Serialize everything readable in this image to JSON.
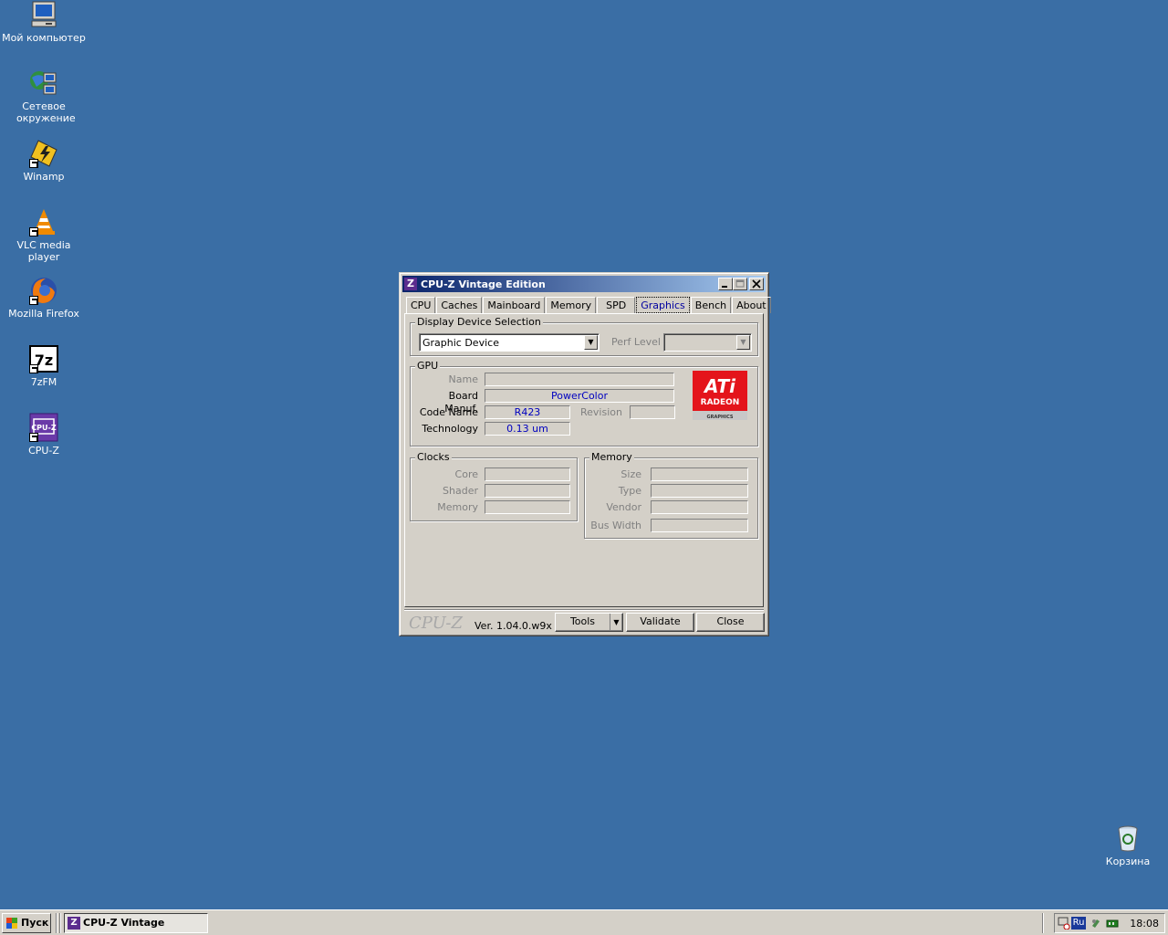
{
  "desktop": {
    "icons": [
      {
        "label": "Мой компьютер",
        "icon": "my-computer-icon"
      },
      {
        "label": "Сетевое окружение",
        "icon": "network-places-icon"
      },
      {
        "label": "Winamp",
        "icon": "winamp-icon"
      },
      {
        "label": "VLC media player",
        "icon": "vlc-icon"
      },
      {
        "label": "Mozilla Firefox",
        "icon": "firefox-icon"
      },
      {
        "label": "7zFM",
        "icon": "7zip-icon"
      },
      {
        "label": "CPU-Z",
        "icon": "cpuz-icon"
      },
      {
        "label": "Корзина",
        "icon": "recycle-bin-icon"
      }
    ]
  },
  "window": {
    "title": "CPU-Z Vintage Edition",
    "app_icon_letter": "Z",
    "tabs": [
      "CPU",
      "Caches",
      "Mainboard",
      "Memory",
      "SPD",
      "Graphics",
      "Bench",
      "About"
    ],
    "active_tab": "Graphics",
    "display_selection": {
      "legend": "Display Device Selection",
      "device": "Graphic Device",
      "perf_level_label": "Perf Level",
      "perf_level_value": ""
    },
    "gpu": {
      "legend": "GPU",
      "name_label": "Name",
      "name_value": "",
      "board_manuf_label": "Board Manuf.",
      "board_manuf_value": "PowerColor",
      "code_name_label": "Code Name",
      "code_name_value": "R423",
      "revision_label": "Revision",
      "revision_value": "",
      "technology_label": "Technology",
      "technology_value": "0.13 um",
      "logo_text_1": "ATi",
      "logo_text_2": "RADEON",
      "logo_text_3": "GRAPHICS"
    },
    "clocks": {
      "legend": "Clocks",
      "core_label": "Core",
      "shader_label": "Shader",
      "memory_label": "Memory"
    },
    "memory": {
      "legend": "Memory",
      "size_label": "Size",
      "type_label": "Type",
      "vendor_label": "Vendor",
      "bus_width_label": "Bus Width"
    },
    "footer": {
      "brand": "CPU-Z",
      "version": "Ver. 1.04.0.w9x",
      "tools": "Tools",
      "validate": "Validate",
      "close": "Close"
    }
  },
  "taskbar": {
    "start_label": "Пуск",
    "task_title": "CPU-Z Vintage Edition",
    "language": "Ru",
    "clock": "18:08"
  },
  "colors": {
    "desktop": "#3a6ea5",
    "face": "#d4d0c8",
    "title_start": "#0a246a",
    "title_end": "#a6caf0",
    "value_text": "#0000c0",
    "ati_red": "#e4141b"
  }
}
